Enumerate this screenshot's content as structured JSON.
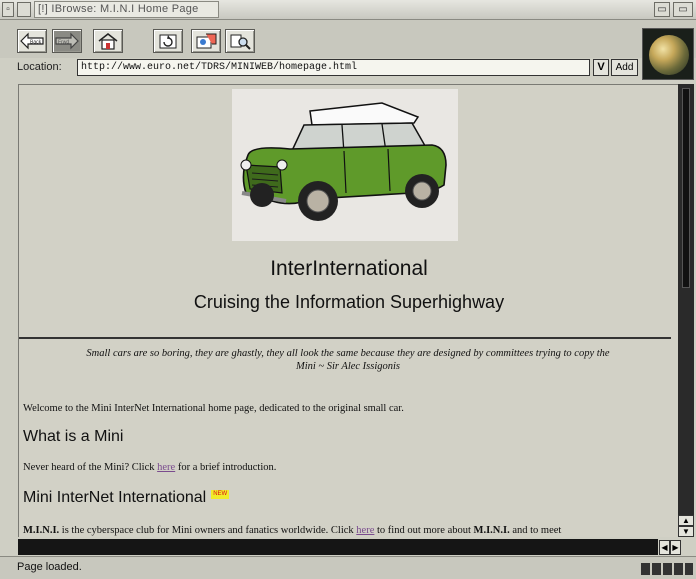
{
  "window": {
    "title": "[!] IBrowse: M.I.N.I Home Page"
  },
  "toolbar": {
    "back_label": "Back",
    "forward_label": "Frwd"
  },
  "location": {
    "label": "Location:",
    "url": "http://www.euro.net/TDRS/MINIWEB/homepage.html",
    "dropdown_label": "V",
    "add_label": "Add"
  },
  "page": {
    "title": "InterInternational",
    "tagline": "Cruising the Information Superhighway",
    "quote_line1": "Small cars are so boring, they are ghastly, they all look the same because they are designed by committees trying to copy the",
    "quote_line2": "Mini ~ Sir Alec Issigonis",
    "welcome": "Welcome to the Mini InterNet International home page, dedicated to the original small car.",
    "section1_heading": "What is a Mini",
    "section1_pre": "Never heard of the Mini? Click ",
    "section1_link": "here",
    "section1_post": " for a brief introduction.",
    "section2_heading": "Mini InterNet International",
    "section2_badge": "NEW",
    "section2_bold1": "M.I.N.I.",
    "section2_pre": " is the cyberspace club for Mini owners and fanatics worldwide. Click ",
    "section2_link": "here",
    "section2_mid": " to find out more about ",
    "section2_bold2": "M.I.N.I.",
    "section2_post": " and to meet"
  },
  "status": {
    "text": "Page loaded."
  },
  "colors": {
    "accent_link": "#7a4b8e",
    "car_body": "#5f9a2a",
    "background": "#d2d1c6"
  }
}
